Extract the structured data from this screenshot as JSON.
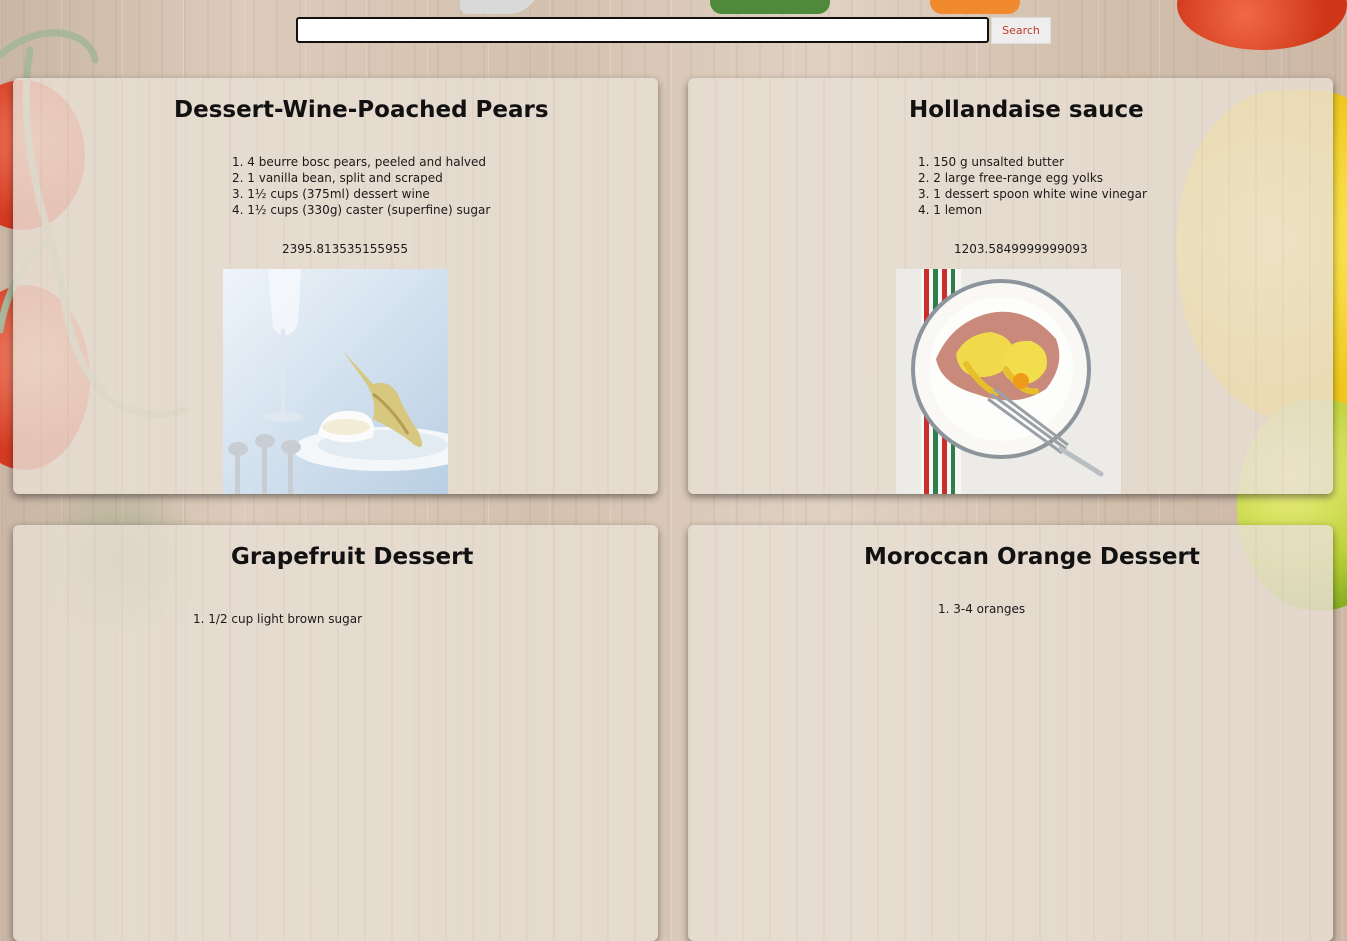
{
  "search": {
    "value": "",
    "placeholder": "",
    "button_label": "Search"
  },
  "recipes": [
    {
      "title": "Dessert-Wine-Poached Pears",
      "ingredients": [
        "1. 4 beurre bosc pears, peeled and halved",
        "2. 1 vanilla bean, split and scraped",
        "3. 1½ cups (375ml) dessert wine",
        "4. 1½ cups (330g) caster (superfine) sugar"
      ],
      "calories": "2395.813535155955"
    },
    {
      "title": "Hollandaise sauce",
      "ingredients": [
        "1. 150 g unsalted butter",
        "2. 2 large free-range egg yolks",
        "3. 1 dessert spoon white wine vinegar",
        "4. 1 lemon"
      ],
      "calories": "1203.5849999999093"
    },
    {
      "title": "Grapefruit Dessert",
      "ingredients": [
        "1. 1/2 cup light brown sugar"
      ],
      "calories": ""
    },
    {
      "title": "Moroccan Orange Dessert",
      "ingredients": [
        "1. 3-4 oranges"
      ],
      "calories": ""
    }
  ],
  "colors": {
    "search_text": "#c0392b",
    "title": "#111111"
  }
}
